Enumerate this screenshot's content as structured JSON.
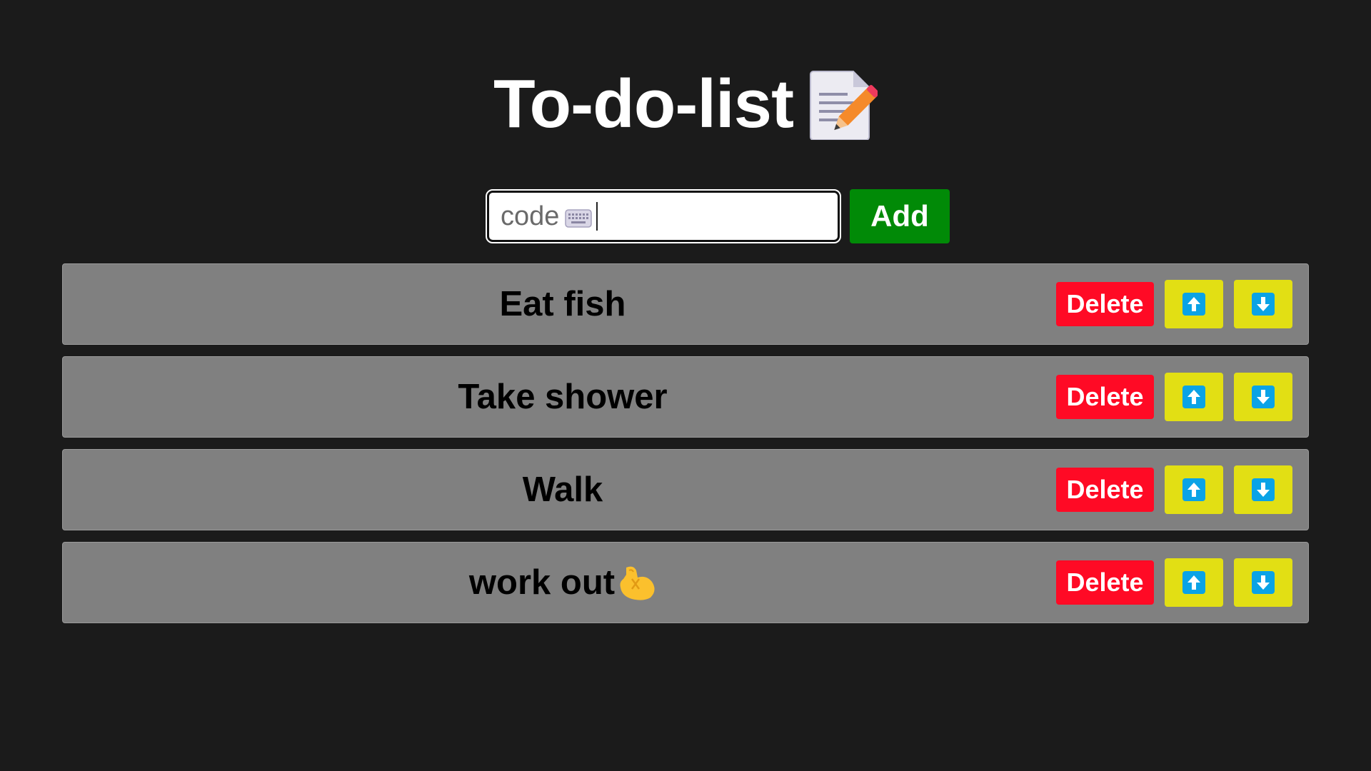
{
  "header": {
    "title": "To-do-list",
    "title_icon": "memo-pencil-icon"
  },
  "add_form": {
    "input_value": "code",
    "input_icon": "keyboard-icon",
    "add_label": "Add"
  },
  "todos": [
    {
      "label": "Eat fish",
      "delete_label": "Delete"
    },
    {
      "label": "Take shower",
      "delete_label": "Delete"
    },
    {
      "label": "Walk",
      "delete_label": "Delete"
    },
    {
      "label": "work out",
      "emoji": "flexed-biceps-icon",
      "delete_label": "Delete"
    }
  ],
  "icons": {
    "move_up": "arrow-up-icon",
    "move_down": "arrow-down-icon"
  },
  "colors": {
    "background": "#1b1b1b",
    "add_button": "#018a07",
    "delete_button": "#ff0a25",
    "move_button": "#e2df14",
    "arrow_tile": "#0aa3e6",
    "item_background": "#808080"
  }
}
